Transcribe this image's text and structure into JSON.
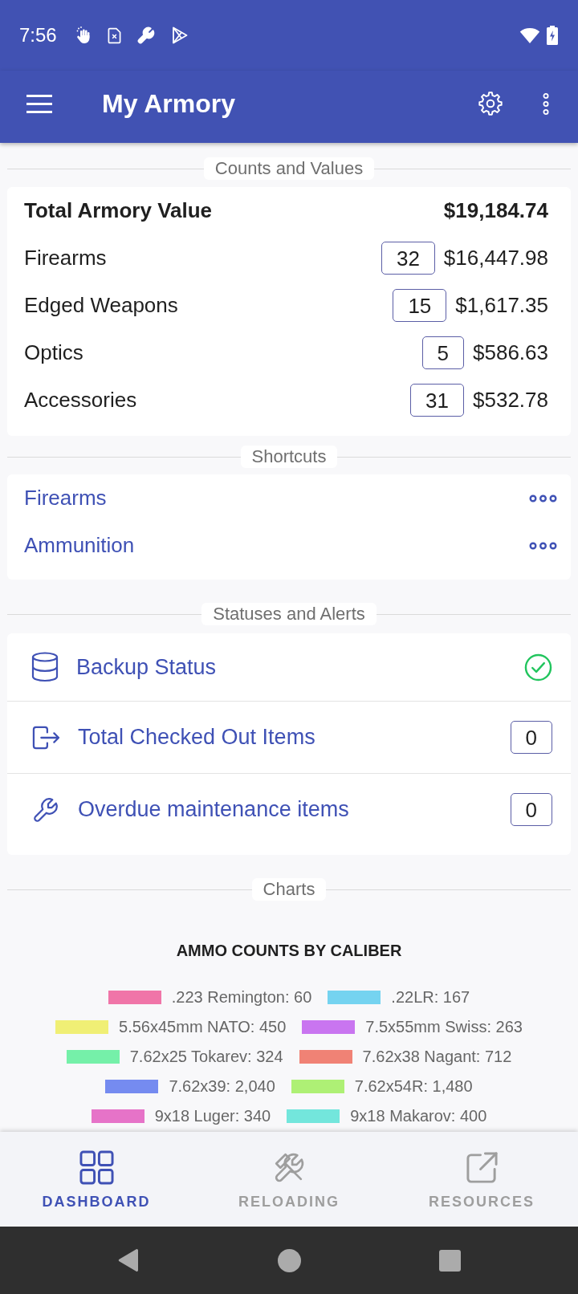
{
  "status_bar": {
    "time": "7:56"
  },
  "app_bar": {
    "title": "My Armory"
  },
  "counts_and_values": {
    "heading": "Counts and Values",
    "total": {
      "label": "Total Armory Value",
      "value": "$19,184.74"
    },
    "rows": [
      {
        "label": "Firearms",
        "count": "32",
        "value": "$16,447.98"
      },
      {
        "label": "Edged Weapons",
        "count": "15",
        "value": "$1,617.35"
      },
      {
        "label": "Optics",
        "count": "5",
        "value": "$586.63"
      },
      {
        "label": "Accessories",
        "count": "31",
        "value": "$532.78"
      }
    ]
  },
  "shortcuts": {
    "heading": "Shortcuts",
    "items": [
      {
        "label": "Firearms"
      },
      {
        "label": "Ammunition"
      }
    ]
  },
  "statuses_and_alerts": {
    "heading": "Statuses and Alerts",
    "items": [
      {
        "kind": "status",
        "label": "Backup Status",
        "ok": true
      },
      {
        "kind": "count",
        "label": "Total Checked Out Items",
        "count": "0"
      },
      {
        "kind": "count",
        "label": "Overdue maintenance items",
        "count": "0"
      }
    ]
  },
  "charts": {
    "heading": "Charts",
    "title": "AMMO COUNTS BY CALIBER",
    "legend": [
      {
        "label": ".223 Remington: 60",
        "color": "#f075a8"
      },
      {
        "label": ".22LR: 167",
        "color": "#75d3f0"
      },
      {
        "label": "5.56x45mm NATO: 450",
        "color": "#f0ef75"
      },
      {
        "label": "7.5x55mm Swiss: 263",
        "color": "#c975f0"
      },
      {
        "label": "7.62x25 Tokarev: 324",
        "color": "#75f0a9"
      },
      {
        "label": "7.62x38 Nagant: 712",
        "color": "#f08275"
      },
      {
        "label": "7.62x39: 2,040",
        "color": "#758bf0"
      },
      {
        "label": "7.62x54R: 1,480",
        "color": "#aef075"
      },
      {
        "label": "9x18 Luger: 340",
        "color": "#e673c8"
      },
      {
        "label": "9x18 Makarov: 400",
        "color": "#73e6dc"
      }
    ]
  },
  "bottom_nav": [
    {
      "label": "DASHBOARD",
      "selected": true
    },
    {
      "label": "RELOADING",
      "selected": false
    },
    {
      "label": "RESOURCES",
      "selected": false
    }
  ]
}
